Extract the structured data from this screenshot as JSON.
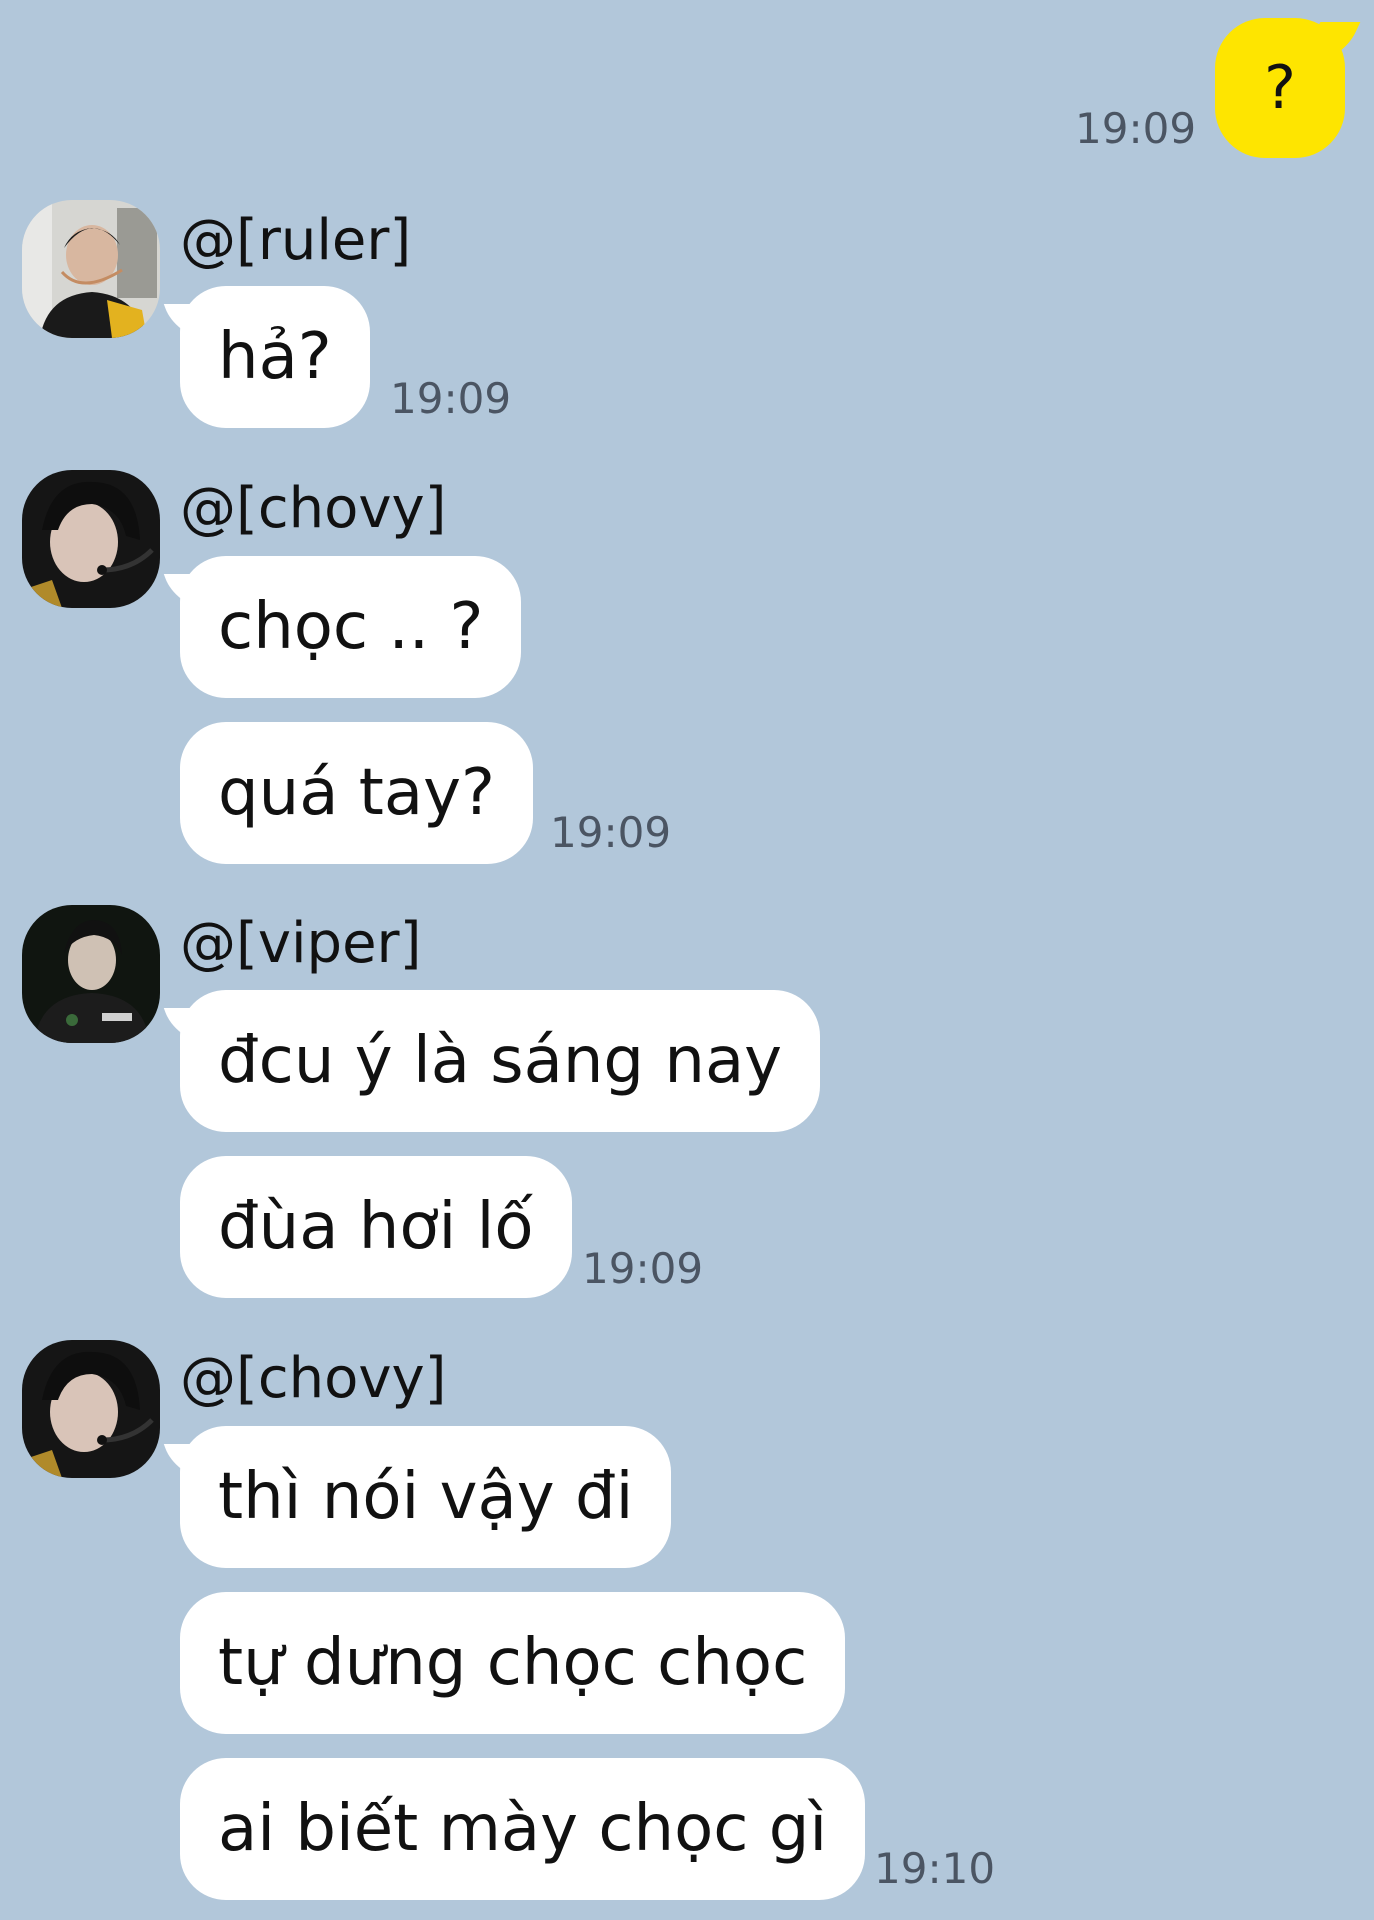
{
  "outgoing": {
    "text": "?",
    "time": "19:09"
  },
  "messages": [
    {
      "sender": "@[ruler]",
      "bubbles": [
        "hả?"
      ],
      "time": "19:09"
    },
    {
      "sender": "@[chovy]",
      "bubbles": [
        "chọc .. ?",
        "quá tay?"
      ],
      "time": "19:09"
    },
    {
      "sender": "@[viper]",
      "bubbles": [
        "đcu ý là sáng nay",
        "đùa hơi lố"
      ],
      "time": "19:09"
    },
    {
      "sender": "@[chovy]",
      "bubbles": [
        "thì nói vậy đi",
        "tự dưng chọc chọc",
        "ai biết mày chọc gì"
      ],
      "time": "19:10"
    }
  ],
  "colors": {
    "background": "#b2c7da",
    "outgoing_bubble": "#fee500",
    "incoming_bubble": "#ffffff"
  }
}
